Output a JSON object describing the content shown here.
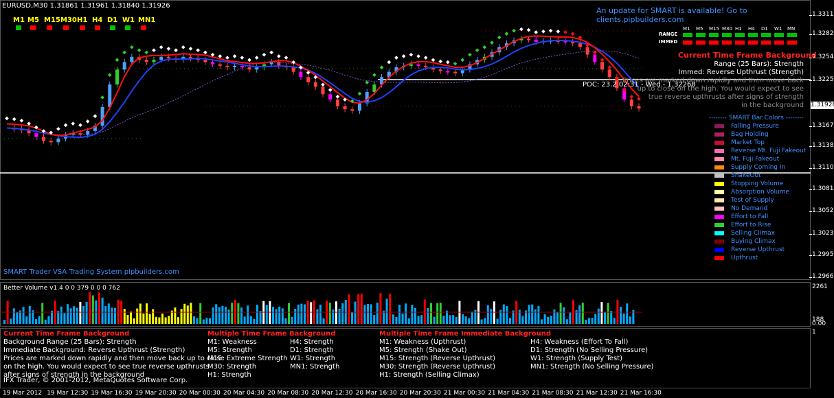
{
  "symbol_header": "EURUSD,M30  1.31861 1.31961 1.31840 1.31926",
  "update_notice": "An update for SMART is available! Go to clients.pipbuilders.com",
  "timeframes": [
    {
      "label": "M1",
      "color": "#00c000"
    },
    {
      "label": "M5",
      "color": "#ff0000"
    },
    {
      "label": "M15",
      "color": "#ff0000"
    },
    {
      "label": "M30",
      "color": "#ff0000"
    },
    {
      "label": "H1",
      "color": "#ff0000"
    },
    {
      "label": "H4",
      "color": "#ff0000"
    },
    {
      "label": "D1",
      "color": "#00c000"
    },
    {
      "label": "W1",
      "color": "#00c000"
    },
    {
      "label": "MN1",
      "color": "#ff0000"
    }
  ],
  "smart_grid": {
    "headers": [
      "M1",
      "M5",
      "M15",
      "M30",
      "H1",
      "H4",
      "D1",
      "W1",
      "MN"
    ],
    "range_label": "RANGE",
    "immed_label": "IMMED",
    "range_colors": [
      "#00c000",
      "#00c000",
      "#00c000",
      "#00c000",
      "#00c000",
      "#00c000",
      "#00c000",
      "#00c000",
      "#00c000"
    ],
    "immed_colors": [
      "#ff0000",
      "#ff0000",
      "#ff0000",
      "#ff0000",
      "#ff0000",
      "#ff0000",
      "#ff0000",
      "#ff0000",
      "#ff0000"
    ]
  },
  "background_panel": {
    "title": "Current Time Frame Background",
    "range": "Range (25 Bars): Strength",
    "immed": "Immed: Reverse Upthrust (Strength)",
    "desc1": "Prices are marked down rapidly and then move back",
    "desc2": "up to close on the high. You would expect to see",
    "desc3": "true reverse upthrusts after signs of strength",
    "desc4": "in the background"
  },
  "poc_label": "POC: 23.2 02:31 - Wed - 1.32268",
  "legend": {
    "title": "-------- SMART Bar Colors --------",
    "items": [
      {
        "label": "Falling Pressure",
        "color": "#8b1a5a"
      },
      {
        "label": "Bag Holding",
        "color": "#b02060"
      },
      {
        "label": "Market Top",
        "color": "#c01030"
      },
      {
        "label": "Reverse Mt. Fuji Fakeout",
        "color": "#ff69b4"
      },
      {
        "label": "Mt. Fuji Fakeout",
        "color": "#ff8ca8"
      },
      {
        "label": "Supply Coming In",
        "color": "#ff8c00"
      },
      {
        "label": "ShakeOut",
        "color": "#c0c0c0"
      },
      {
        "label": "Stopping Volume",
        "color": "#ffff00"
      },
      {
        "label": "Absorption Volume",
        "color": "#ffffa0"
      },
      {
        "label": "Test of Supply",
        "color": "#ffe4b5"
      },
      {
        "label": "No Demand",
        "color": "#ffc0cb"
      },
      {
        "label": "Effort to Fall",
        "color": "#ff00ff"
      },
      {
        "label": "Effort to Rise",
        "color": "#32cd32"
      },
      {
        "label": "Selling Climax",
        "color": "#00ffff"
      },
      {
        "label": "Buying Climax",
        "color": "#800000"
      },
      {
        "label": "Reverse Upthrust",
        "color": "#0000ff"
      },
      {
        "label": "Upthrust",
        "color": "#ff0000"
      }
    ]
  },
  "price_axis": [
    "1.33110",
    "1.32825",
    "1.32540",
    "1.32250",
    "1.31926",
    "1.31675",
    "1.31385",
    "1.31100",
    "1.30810",
    "1.30525",
    "1.30235",
    "1.29950",
    "1.29660"
  ],
  "current_price": "1.31926",
  "footer_text": "SMART Trader VSA Trading System pipbuilders.com",
  "volume_label": "Better Volume v1.4 0 0 379 0 0 0 762",
  "volume_axis": [
    "2261",
    "188",
    "0.00"
  ],
  "indicator": {
    "col1_title": "Current Time Frame Background",
    "col1_lines": [
      "Background Range (25 Bars): Strength",
      "Immediate Background: Reverse Upthrust (Strength)"
    ],
    "col1_desc": [
      "Prices are marked down rapidly and then move back up to close",
      "on the high. You would expect to see true reverse upthrusts",
      "after signs of strength in the background"
    ],
    "col2_title": "Multiple Time Frame Background",
    "col2_rows": [
      [
        "M1:   Weakness",
        "H4:  Strength"
      ],
      [
        "M5:   Strength",
        "D1:  Strength"
      ],
      [
        "M15: Extreme Strength",
        "W1:   Strength"
      ],
      [
        "M30: Strength",
        "MN1: Strength"
      ],
      [
        "H1:   Strength",
        ""
      ]
    ],
    "col3_title": "Multiple Time Frame Immediate Background",
    "col3_rows": [
      [
        "M1:   Weakness (Upthrust)",
        "H4:  Weakness (Effort To Fall)"
      ],
      [
        "M5:   Strength (Shake Out)",
        "D1:  Strength (No Selling Pressure)"
      ],
      [
        "M15: Strength (Reverse Upthrust)",
        "W1:   Strength (Supply Test)"
      ],
      [
        "M30: Strength (Reverse Upthrust)",
        "MN1: Strength (No Selling Pressure)"
      ],
      [
        "H1:   Strength (Selling Climax)",
        ""
      ]
    ]
  },
  "copyright": "IFX Trader, © 2001-2012, MetaQuotes Software Corp.",
  "indicator_axis": "1",
  "time_axis": [
    "19 Mar 2012",
    "19 Mar 12:30",
    "19 Mar 16:30",
    "19 Mar 20:30",
    "20 Mar 00:30",
    "20 Mar 04:30",
    "20 Mar 08:30",
    "20 Mar 12:30",
    "20 Mar 16:30",
    "20 Mar 20:30",
    "21 Mar 00:30",
    "21 Mar 04:30",
    "21 Mar 08:30",
    "21 Mar 12:30",
    "21 Mar 16:30"
  ],
  "chart_data": {
    "type": "line",
    "title": "EURUSD,M30",
    "ylim": [
      1.2966,
      1.3325
    ],
    "closes": [
      1.3167,
      1.3166,
      1.3164,
      1.316,
      1.3155,
      1.315,
      1.3148,
      1.3153,
      1.3158,
      1.316,
      1.3158,
      1.3163,
      1.317,
      1.3195,
      1.3225,
      1.3245,
      1.3255,
      1.3262,
      1.3258,
      1.3255,
      1.3258,
      1.3262,
      1.326,
      1.3258,
      1.3262,
      1.326,
      1.3258,
      1.3255,
      1.3252,
      1.325,
      1.3248,
      1.325,
      1.3248,
      1.3245,
      1.3248,
      1.3252,
      1.3255,
      1.325,
      1.3248,
      1.3242,
      1.3235,
      1.3228,
      1.3222,
      1.3212,
      1.3205,
      1.3196,
      1.3192,
      1.319,
      1.32,
      1.3215,
      1.3225,
      1.3235,
      1.3242,
      1.3248,
      1.325,
      1.3252,
      1.325,
      1.3248,
      1.3245,
      1.3243,
      1.3242,
      1.324,
      1.3245,
      1.3252,
      1.3258,
      1.3262,
      1.3268,
      1.3275,
      1.328,
      1.3284,
      1.3286,
      1.3285,
      1.3282,
      1.3283,
      1.3284,
      1.3283,
      1.3282,
      1.328,
      1.3275,
      1.3265,
      1.3255,
      1.3245,
      1.3235,
      1.322,
      1.3205,
      1.3196,
      1.3193
    ]
  }
}
